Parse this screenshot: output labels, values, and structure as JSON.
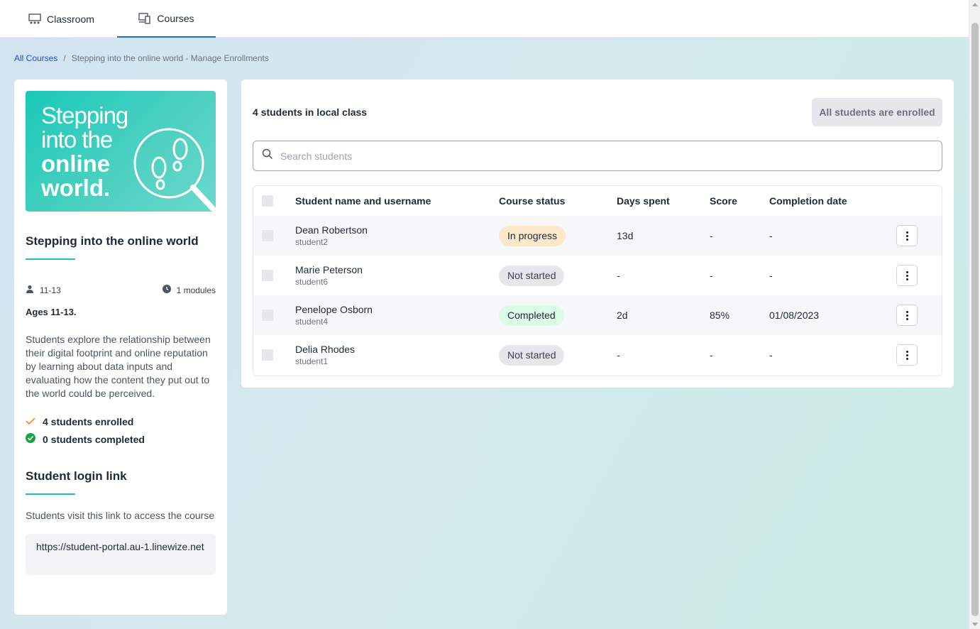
{
  "nav": {
    "tabs": [
      {
        "label": "Classroom",
        "icon": "classroom-icon",
        "active": false
      },
      {
        "label": "Courses",
        "icon": "devices-icon",
        "active": true
      }
    ]
  },
  "breadcrumb": {
    "root": "All Courses",
    "separator": "/",
    "current": "Stepping into the online world - Manage Enrollments"
  },
  "course": {
    "hero": {
      "line1": "Stepping",
      "line2": "into the",
      "line3": "online",
      "line4": "world."
    },
    "title": "Stepping into the online world",
    "age_range": "11-13",
    "modules": "1 modules",
    "ages_heading": "Ages 11-13.",
    "description": "Students explore the relationship between their digital footprint and online reputation by learning about data inputs and evaluating how the content they put out to the world could be perceived.",
    "enrolled_text": "4 students enrolled",
    "completed_text": "0 students completed",
    "login_title": "Student login link",
    "login_desc": "Students visit this link to access the course",
    "login_link": "https://student-portal.au-1.linewize.net"
  },
  "main": {
    "count_title": "4 students in local class",
    "enrolled_button": "All students are enrolled",
    "search_placeholder": "Search students",
    "columns": [
      "Student name and username",
      "Course status",
      "Days spent",
      "Score",
      "Completion date"
    ],
    "students": [
      {
        "name": "Dean Robertson",
        "username": "student2",
        "status": "In progress",
        "status_type": "progress",
        "days": "13d",
        "score": "-",
        "date": "-"
      },
      {
        "name": "Marie Peterson",
        "username": "student6",
        "status": "Not started",
        "status_type": "notstarted",
        "days": "-",
        "score": "-",
        "date": "-"
      },
      {
        "name": "Penelope Osborn",
        "username": "student4",
        "status": "Completed",
        "status_type": "completed",
        "days": "2d",
        "score": "85%",
        "date": "01/08/2023"
      },
      {
        "name": "Delia Rhodes",
        "username": "student1",
        "status": "Not started",
        "status_type": "notstarted",
        "days": "-",
        "score": "-",
        "date": "-"
      }
    ]
  },
  "colors": {
    "accent": "#21c1b4",
    "link": "#1d4ed8",
    "tab_active": "#1d6fb8",
    "pill_progress": "#fde8cc",
    "pill_notstarted": "#e5e7eb",
    "pill_completed": "#dcfce7"
  }
}
